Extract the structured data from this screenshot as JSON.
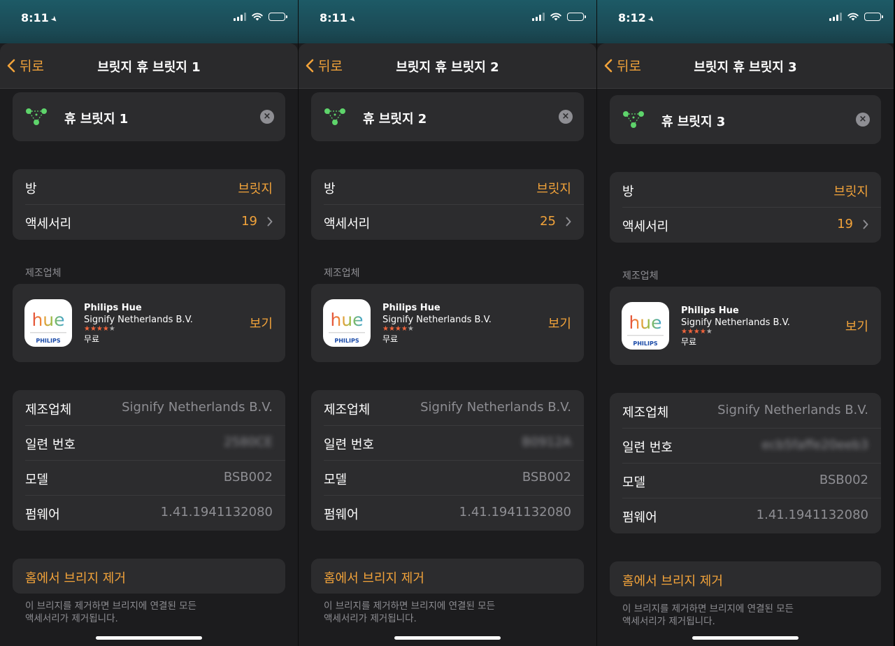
{
  "icons": {
    "back": "chevron-left-icon",
    "hub": "hub-bridge-icon",
    "clear": "clear-icon",
    "disclosure": "chevron-right-icon",
    "location": "location-arrow-icon",
    "signal": "cellular-signal-icon",
    "wifi": "wifi-icon",
    "battery": "battery-icon"
  },
  "colors": {
    "accent": "#f2a33a",
    "background": "#1c1c1e",
    "card": "#2c2c2e",
    "secondary_text": "#8e8e93",
    "hub_icon": "#5ed46b",
    "status_bar": "#1d5a66"
  },
  "screens": [
    {
      "status": {
        "time": "8:11"
      },
      "nav": {
        "back_label": "뒤로",
        "title": "브릿지 휴 브릿지 1"
      },
      "device": {
        "name": "휴 브릿지 1",
        "clear_glyph": "×"
      },
      "info": [
        {
          "label": "방",
          "value": "브릿지"
        },
        {
          "label": "액세서리",
          "value": "19"
        }
      ],
      "manufacturer_header": "제조업체",
      "app": {
        "icon_text": "hue",
        "icon_brand": "PHILIPS",
        "name": "Philips Hue",
        "developer": "Signify Netherlands B.V.",
        "rating": 4.5,
        "price": "무료",
        "action": "보기"
      },
      "details": [
        {
          "label": "제조업체",
          "value": "Signify Netherlands B.V."
        },
        {
          "label": "일련 번호",
          "value": "2580CE"
        },
        {
          "label": "모델",
          "value": "BSB002"
        },
        {
          "label": "펌웨어",
          "value": "1.41.1941132080"
        }
      ],
      "remove": {
        "label": "홈에서 브리지 제거",
        "footnote_line1": "이 브리지를 제거하면 브리지에 연결된 모든",
        "footnote_line2": "액세서리가 제거됩니다."
      }
    },
    {
      "status": {
        "time": "8:11"
      },
      "nav": {
        "back_label": "뒤로",
        "title": "브릿지 휴 브릿지 2"
      },
      "device": {
        "name": "휴 브릿지 2",
        "clear_glyph": "×"
      },
      "info": [
        {
          "label": "방",
          "value": "브릿지"
        },
        {
          "label": "액세서리",
          "value": "25"
        }
      ],
      "manufacturer_header": "제조업체",
      "app": {
        "icon_text": "hue",
        "icon_brand": "PHILIPS",
        "name": "Philips Hue",
        "developer": "Signify Netherlands B.V.",
        "rating": 4.5,
        "price": "무료",
        "action": "보기"
      },
      "details": [
        {
          "label": "제조업체",
          "value": "Signify Netherlands B.V."
        },
        {
          "label": "일련 번호",
          "value": "B0912A"
        },
        {
          "label": "모델",
          "value": "BSB002"
        },
        {
          "label": "펌웨어",
          "value": "1.41.1941132080"
        }
      ],
      "remove": {
        "label": "홈에서 브리지 제거",
        "footnote_line1": "이 브리지를 제거하면 브리지에 연결된 모든",
        "footnote_line2": "액세서리가 제거됩니다."
      }
    },
    {
      "status": {
        "time": "8:12"
      },
      "nav": {
        "back_label": "뒤로",
        "title": "브릿지 휴 브릿지 3"
      },
      "device": {
        "name": "휴 브릿지 3",
        "clear_glyph": "×"
      },
      "info": [
        {
          "label": "방",
          "value": "브릿지"
        },
        {
          "label": "액세서리",
          "value": "19"
        }
      ],
      "manufacturer_header": "제조업체",
      "app": {
        "icon_text": "hue",
        "icon_brand": "PHILIPS",
        "name": "Philips Hue",
        "developer": "Signify Netherlands B.V.",
        "rating": 4.5,
        "price": "무료",
        "action": "보기"
      },
      "details": [
        {
          "label": "제조업체",
          "value": "Signify Netherlands B.V."
        },
        {
          "label": "일련 번호",
          "value": "ecb5faffe20eeb3"
        },
        {
          "label": "모델",
          "value": "BSB002"
        },
        {
          "label": "펌웨어",
          "value": "1.41.1941132080"
        }
      ],
      "remove": {
        "label": "홈에서 브리지 제거",
        "footnote_line1": "이 브리지를 제거하면 브리지에 연결된 모든",
        "footnote_line2": "액세서리가 제거됩니다."
      }
    }
  ]
}
